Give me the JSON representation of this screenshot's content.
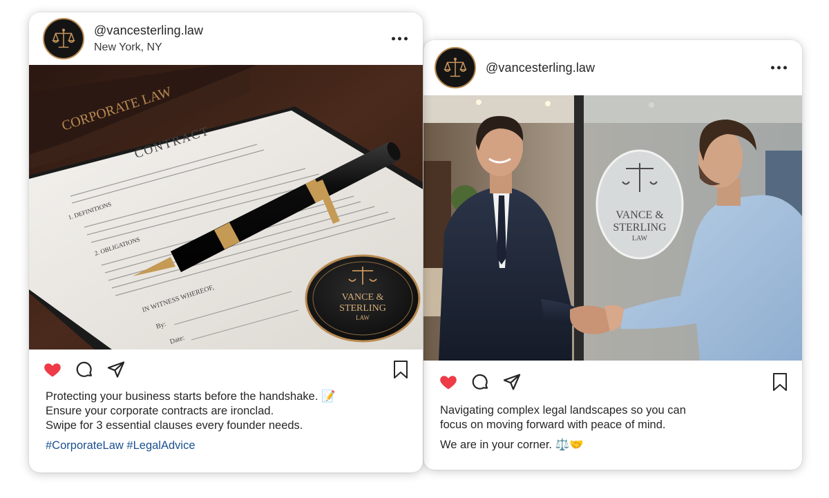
{
  "colors": {
    "like_red": "#ed3b47",
    "hashtag_blue": "#1b4f91",
    "brand_gold": "#b98a52"
  },
  "post1": {
    "username": "@vancesterling.law",
    "location": "New York, NY",
    "more_icon": "more-horizontal-icon",
    "photo": {
      "book_spine_text": "CORPORATE LAW",
      "doc_title": "CONTRACT",
      "section_1": "1. DEFINITIONS",
      "section_2": "2. OBLIGATIONS",
      "witness": "IN WITNESS WHEREOF,",
      "by": "By:",
      "date": "Date:",
      "seal_line1": "VANCE &",
      "seal_line2": "STERLING",
      "seal_line3": "LAW"
    },
    "actions": {
      "like": "heart-filled-icon",
      "comment": "comment-icon",
      "share": "share-icon",
      "save": "bookmark-icon"
    },
    "caption": {
      "line1": "Protecting your business starts before the handshake. 📝",
      "line2": "Ensure your corporate contracts are ironclad.",
      "line3": "Swipe for 3 essential clauses every founder needs."
    },
    "hashtags": [
      "#CorporateLaw",
      "#LegalAdvice"
    ]
  },
  "post2": {
    "username": "@vancesterling.law",
    "more_icon": "more-horizontal-icon",
    "photo": {
      "glass_line1": "VANCE &",
      "glass_line2": "STERLING",
      "glass_line3": "LAW"
    },
    "actions": {
      "like": "heart-filled-icon",
      "comment": "comment-icon",
      "share": "share-icon",
      "save": "bookmark-icon"
    },
    "caption": {
      "line1": "Navigating complex legal landscapes so you can",
      "line2": "focus on moving forward with peace of mind.",
      "line3": "We are in your corner. ⚖️🤝"
    }
  }
}
